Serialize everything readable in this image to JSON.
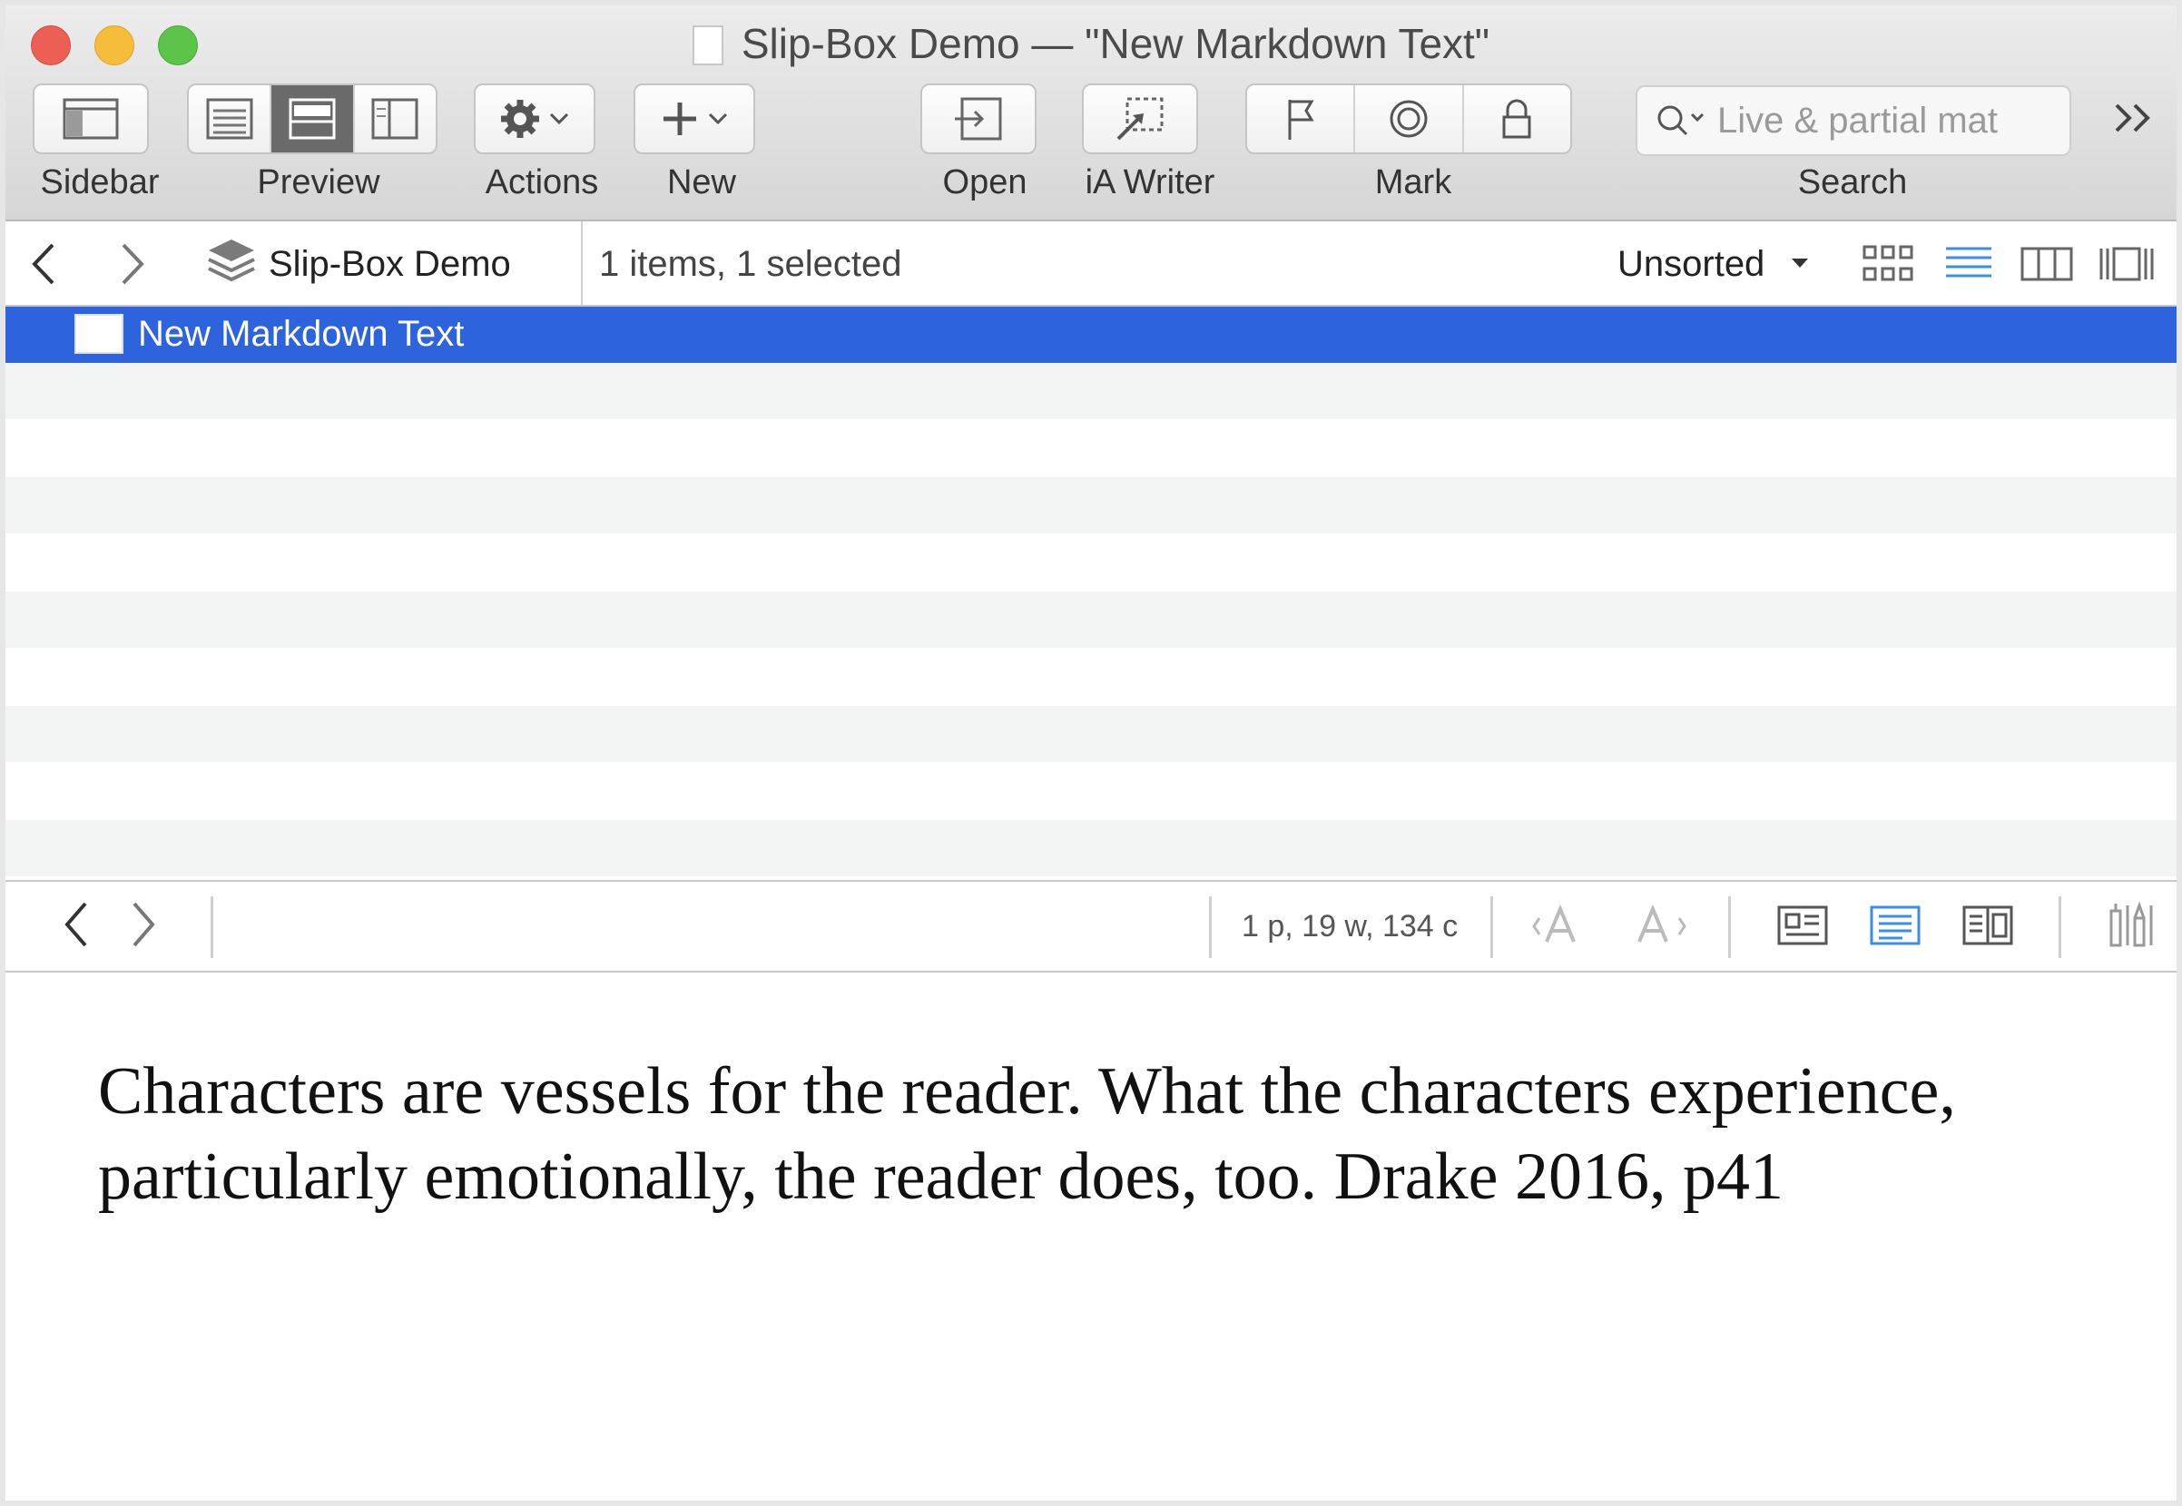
{
  "window": {
    "title": "Slip-Box Demo — \"New Markdown Text\""
  },
  "toolbar": {
    "sidebar_label": "Sidebar",
    "preview_label": "Preview",
    "actions_label": "Actions",
    "new_label": "New",
    "open_label": "Open",
    "iawriter_label": "iA Writer",
    "mark_label": "Mark",
    "search_label": "Search",
    "search_placeholder": "Live & partial mat"
  },
  "pathbar": {
    "group_name": "Slip-Box Demo",
    "item_count": "1 items, 1 selected",
    "sort_label": "Unsorted"
  },
  "list": {
    "items": [
      {
        "title": "New Markdown Text",
        "selected": true
      }
    ]
  },
  "editor_bar": {
    "stats": "1 p, 19 w, 134 c"
  },
  "editor": {
    "text": "Characters are vessels for the reader. What the characters experience, particularly emotionally, the reader does, too. Drake 2016, p41"
  },
  "colors": {
    "selection": "#2d63dc",
    "accent_blue": "#3b8fe0"
  }
}
